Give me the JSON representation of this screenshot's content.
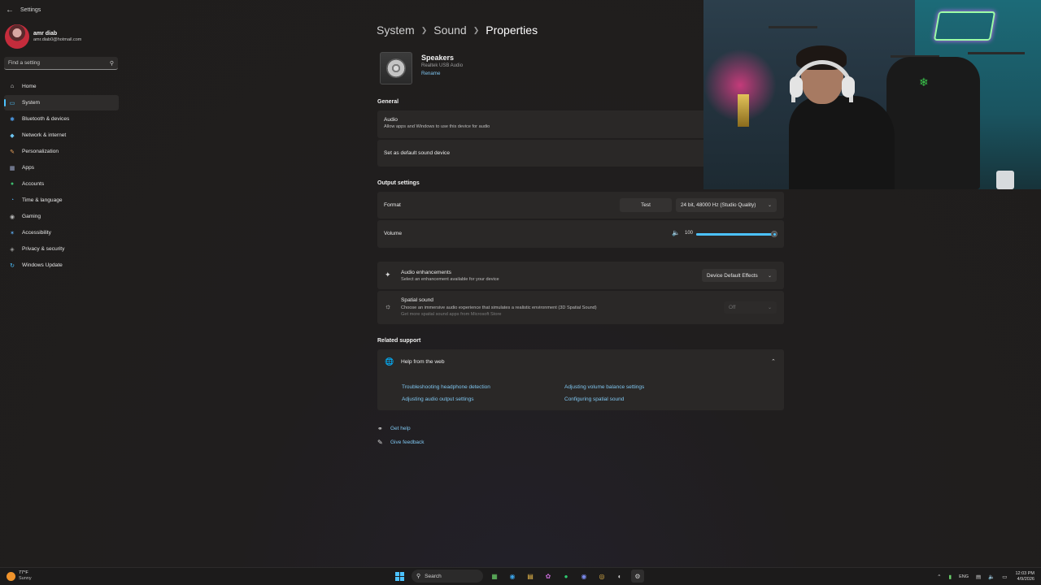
{
  "window": {
    "app_title": "Settings",
    "back_icon": "back-arrow-icon"
  },
  "sidebar": {
    "profile": {
      "name": "amr diab",
      "email": "amr.diab0@hotmail.com"
    },
    "search": {
      "placeholder": "Find a setting",
      "icon": "search-icon"
    },
    "items": [
      {
        "label": "Home",
        "icon": "home-icon",
        "color": "#e8e8e8",
        "active": false
      },
      {
        "label": "System",
        "icon": "system-icon",
        "color": "#4cc2ff",
        "active": true
      },
      {
        "label": "Bluetooth & devices",
        "icon": "bluetooth-icon",
        "color": "#4c9be8",
        "active": false
      },
      {
        "label": "Network & internet",
        "icon": "network-icon",
        "color": "#6cc4f0",
        "active": false
      },
      {
        "label": "Personalization",
        "icon": "brush-icon",
        "color": "#e8a25b",
        "active": false
      },
      {
        "label": "Apps",
        "icon": "apps-icon",
        "color": "#9aa6c8",
        "active": false
      },
      {
        "label": "Accounts",
        "icon": "accounts-icon",
        "color": "#3dbb6e",
        "active": false
      },
      {
        "label": "Time & language",
        "icon": "globe-clock-icon",
        "color": "#4ca3e0",
        "active": false
      },
      {
        "label": "Gaming",
        "icon": "gaming-icon",
        "color": "#b8b8b8",
        "active": false
      },
      {
        "label": "Accessibility",
        "icon": "accessibility-icon",
        "color": "#5aa6e8",
        "active": false
      },
      {
        "label": "Privacy & security",
        "icon": "shield-icon",
        "color": "#9a9a9a",
        "active": false
      },
      {
        "label": "Windows Update",
        "icon": "update-icon",
        "color": "#4cc2ff",
        "active": false
      }
    ]
  },
  "breadcrumb": {
    "items": [
      "System",
      "Sound"
    ],
    "current": "Properties"
  },
  "device": {
    "name": "Speakers",
    "subtitle": "Realtek USB Audio",
    "rename_label": "Rename"
  },
  "general": {
    "header": "General",
    "audio_title": "Audio",
    "audio_desc": "Allow apps and Windows to use this device for audio",
    "default_device": "Set as default sound device"
  },
  "output": {
    "header": "Output settings",
    "format_label": "Format",
    "test_label": "Test",
    "format_value": "24 bit, 48000 Hz (Studio Quality)",
    "volume_label": "Volume",
    "volume_value": "100",
    "volume_fraction": 1.0
  },
  "enhancements": {
    "title": "Audio enhancements",
    "desc": "Select an enhancement available for your device",
    "value": "Device Default Effects"
  },
  "spatial": {
    "title": "Spatial sound",
    "desc": "Choose an immersive audio experience that simulates a realistic environment (3D Spatial Sound)",
    "desc2": "Get more spatial sound apps from Microsoft Store",
    "value": "Off"
  },
  "support": {
    "header": "Related support",
    "help_title": "Help from the web",
    "links": [
      "Troubleshooting headphone detection",
      "Adjusting volume balance settings",
      "Adjusting audio output settings",
      "Configuring spatial sound"
    ]
  },
  "footer": {
    "get_help": "Get help",
    "give_feedback": "Give feedback"
  },
  "taskbar": {
    "weather_temp": "77°F",
    "weather_cond": "Sunny",
    "search_label": "Search",
    "lang": "ENG",
    "time": "12:03 PM",
    "date": "4/9/2026"
  },
  "colors": {
    "accent": "#4cc2ff",
    "link": "#7fc6f0"
  }
}
